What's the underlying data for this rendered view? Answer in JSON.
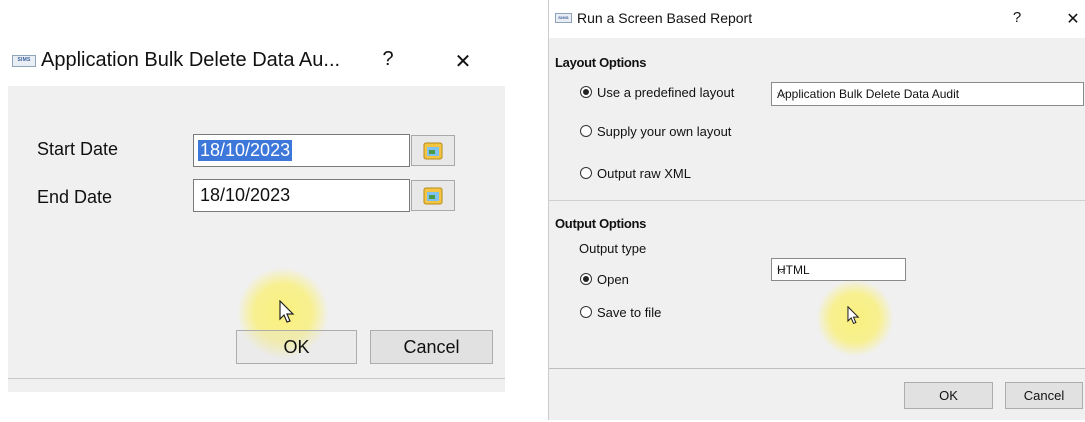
{
  "left_dialog": {
    "title": "Application Bulk Delete Data Au...",
    "icon_text": "SIMS",
    "help": "?",
    "close": "✕",
    "start_date_label": "Start Date",
    "start_date_value": "18/10/2023",
    "end_date_label": "End Date",
    "end_date_value": "18/10/2023",
    "ok_label": "OK",
    "cancel_label": "Cancel"
  },
  "right_dialog": {
    "title": "Run a Screen Based Report",
    "icon_text": "SIMS",
    "help": "?",
    "close": "✕",
    "layout_section": "Layout Options",
    "layout_opt_predefined": "Use a predefined layout",
    "layout_opt_own": "Supply your own layout",
    "layout_opt_raw": "Output raw XML",
    "layout_combo_value": "Application Bulk Delete Data Audit",
    "output_section": "Output Options",
    "output_type_label": "Output type",
    "output_opt_open": "Open",
    "output_opt_save": "Save to file",
    "output_combo_value": "HTML",
    "ok_label": "OK",
    "cancel_label": "Cancel"
  },
  "colors": {
    "selection": "#3d77d9",
    "highlight": "#faf078",
    "dialog_bg": "#f0f0f0"
  }
}
